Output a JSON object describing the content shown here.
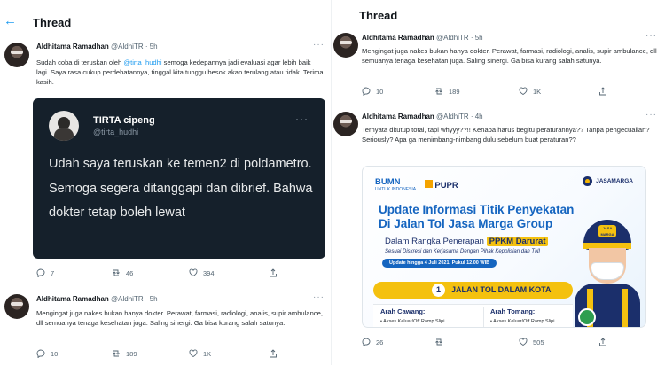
{
  "left": {
    "header": {
      "title": "Thread"
    },
    "tweet1": {
      "name": "Aldhitama Ramadhan",
      "handle": "@AldhiTR",
      "time": "· 5h",
      "text_before_link": "Sudah coba di teruskan oleh ",
      "link": "@tirta_hudhi",
      "text_after_link": " semoga kedepannya jadi evaluasi agar lebih baik lagi. Saya rasa cukup perdebatannya, tinggal kita tunggu besok akan terulang atau tidak. Terima kasih.",
      "quote": {
        "name": "TIRTA cipeng",
        "handle": "@tirta_hudhi",
        "text": "Udah saya teruskan ke temen2 di poldametro. Semoga segera ditanggapi dan dibrief. Bahwa dokter tetap boleh lewat"
      },
      "replies": "7",
      "retweets": "46",
      "likes": "394"
    },
    "tweet2": {
      "name": "Aldhitama Ramadhan",
      "handle": "@AldhiTR",
      "time": "· 5h",
      "text": "Mengingat juga nakes bukan hanya dokter. Perawat, farmasi, radiologi, analis, supir ambulance, dll semuanya tenaga kesehatan juga. Saling sinergi. Ga bisa kurang salah satunya.",
      "replies": "10",
      "retweets": "189",
      "likes": "1K"
    }
  },
  "right": {
    "header": {
      "title": "Thread"
    },
    "tweet1": {
      "name": "Aldhitama Ramadhan",
      "handle": "@AldhiTR",
      "time": "· 5h",
      "text": "Mengingat juga nakes bukan hanya dokter. Perawat, farmasi, radiologi, analis, supir ambulance, dll semuanya tenaga kesehatan juga. Saling sinergi. Ga bisa kurang salah satunya.",
      "replies": "10",
      "retweets": "189",
      "likes": "1K"
    },
    "tweet2": {
      "name": "Aldhitama Ramadhan",
      "handle": "@AldhiTR",
      "time": "· 4h",
      "text": "Ternyata ditutup total, tapi whyyy??!! Kenapa harus begitu peraturannya?? Tanpa pengecualian? Seriously? Apa ga menimbang-nimbang dulu sebelum buat peraturan??",
      "replies": "26",
      "retweets": "",
      "likes": "505"
    },
    "media": {
      "logo_bumn": "BUMN",
      "logo_bumn_sub": "UNTUK INDONESIA",
      "logo_pupr": "PUPR",
      "logo_jm": "JASAMARGA",
      "title_line1": "Update Informasi Titik Penyekatan",
      "title_line2": "Di Jalan Tol Jasa Marga Group",
      "subtitle": "Dalam Rangka Penerapan",
      "badge": "PPKM Darurat",
      "disclaimer": "Sesuai Diskresi dan Kerjasama Dengan Pihak Kepolisian dan TNI",
      "update": "Update hingga 4 Juli 2021, Pukul 12.00 WIB",
      "section_number": "1",
      "section_label": "JALAN TOL DALAM KOTA",
      "route_left": "Arah Cawang:",
      "route_left_sub": "• Akses Keluar/Off Ramp Slipi",
      "route_right": "Arah Tomang:",
      "route_right_sub": "• Akses Keluar/Off Ramp Slipi",
      "helmet_badge": "JASA MARGA"
    }
  }
}
